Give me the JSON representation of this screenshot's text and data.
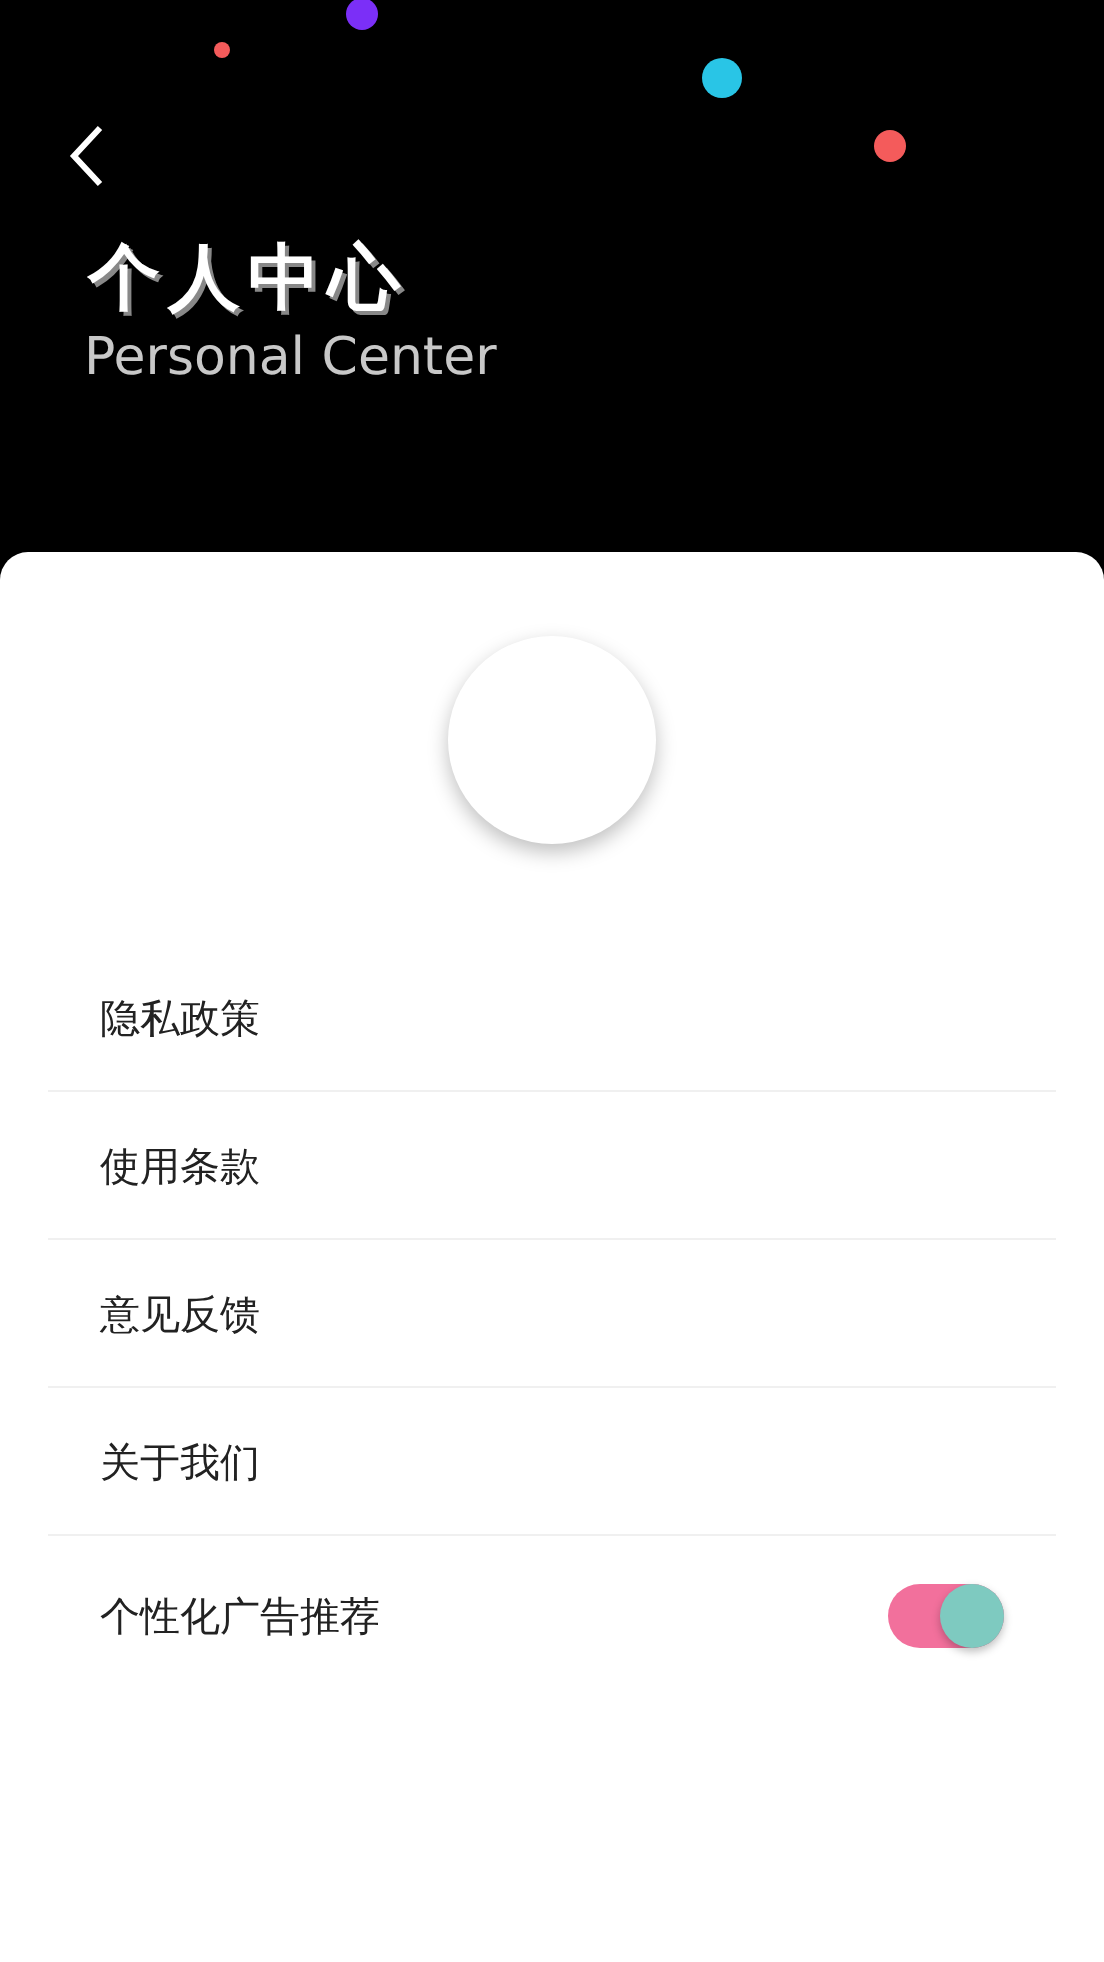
{
  "header": {
    "title": "个人中心",
    "subtitle": "Personal Center"
  },
  "menu": [
    {
      "label": "隐私政策",
      "kind": "link"
    },
    {
      "label": "使用条款",
      "kind": "link"
    },
    {
      "label": "意见反馈",
      "kind": "link"
    },
    {
      "label": "关于我们",
      "kind": "link"
    },
    {
      "label": "个性化广告推荐",
      "kind": "toggle",
      "on": true
    }
  ]
}
